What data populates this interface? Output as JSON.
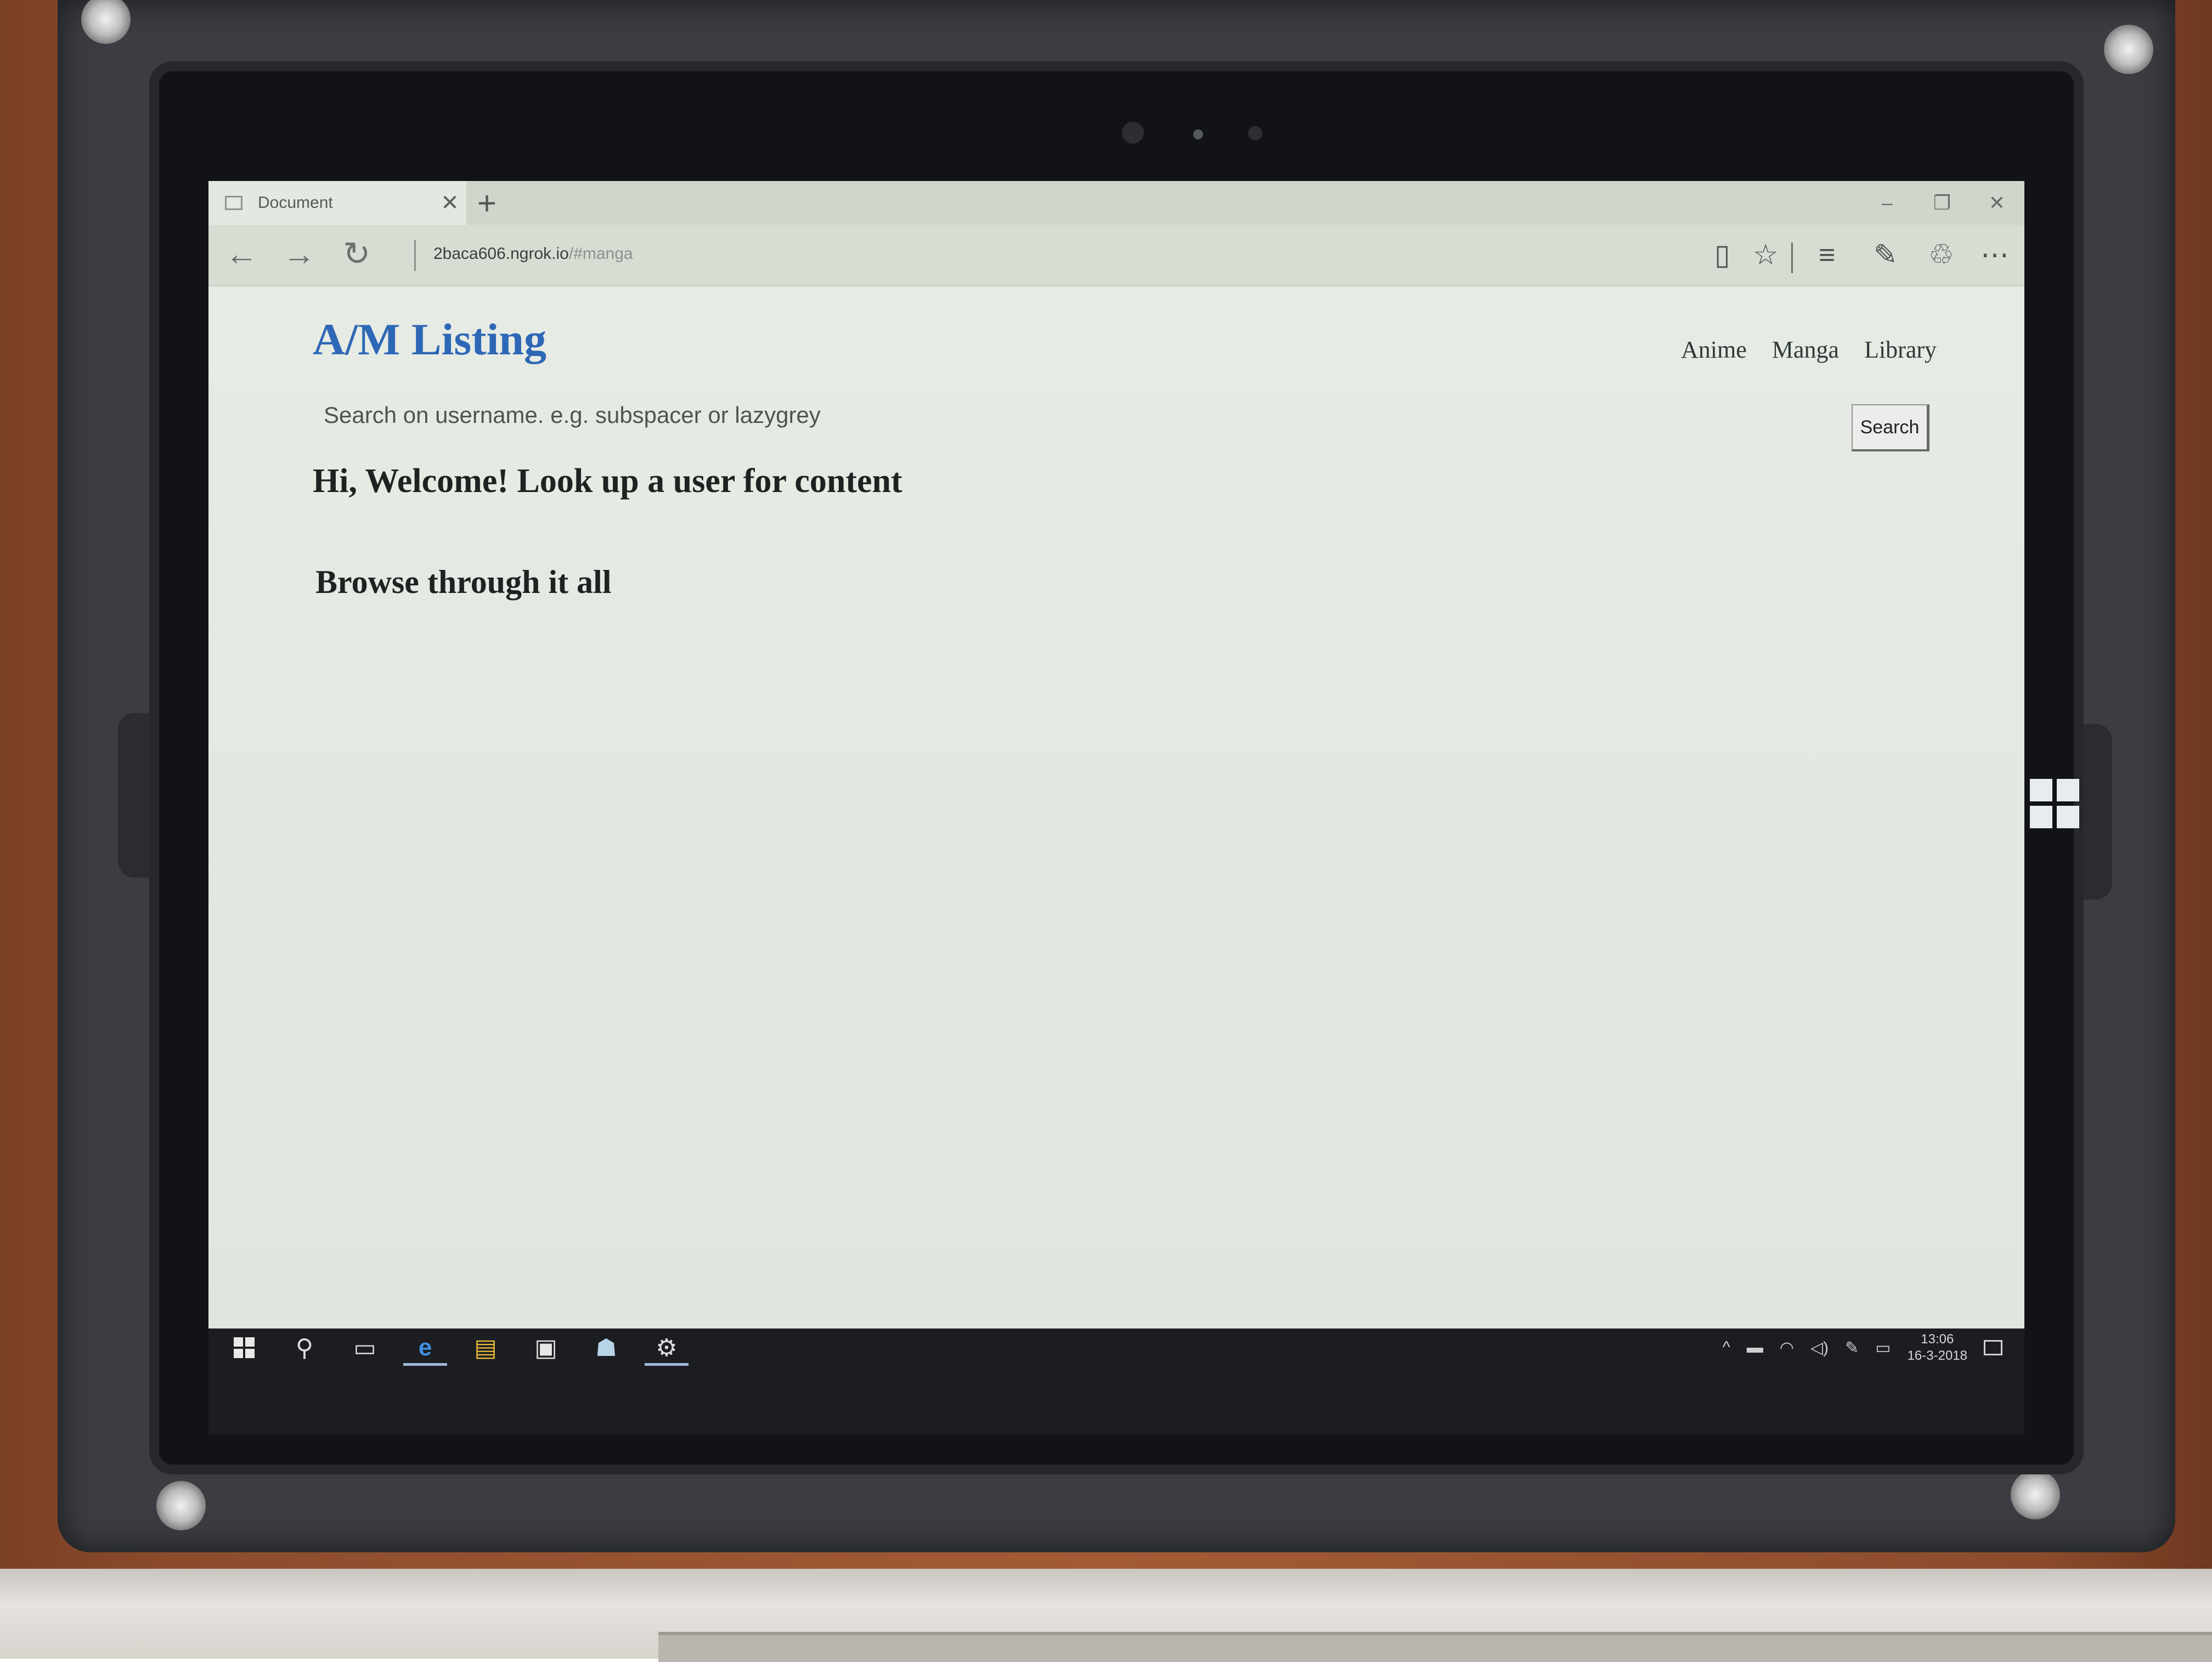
{
  "browser": {
    "tab": {
      "title": "Document",
      "close_icon": "✕"
    },
    "new_tab_icon": "+",
    "window_controls": {
      "minimize": "–",
      "restore": "❐",
      "close": "✕"
    },
    "nav": {
      "back_icon": "←",
      "forward_icon": "→",
      "refresh_icon": "↻"
    },
    "url": {
      "host": "2baca606.ngrok.io",
      "path": "/#manga"
    },
    "toolbar": {
      "reading_view_icon": "▯",
      "favorite_icon": "☆",
      "hub_icon": "≡",
      "web_note_icon": "✎",
      "share_icon": "♲",
      "more_icon": "⋯"
    }
  },
  "page": {
    "site_title": "A/M Listing",
    "nav_links": [
      "Anime",
      "Manga",
      "Library"
    ],
    "search": {
      "placeholder": "Search on username. e.g. subspacer or lazygrey",
      "button_label": "Search"
    },
    "welcome_heading": "Hi, Welcome! Look up a user for content",
    "browse_heading": "Browse through it all"
  },
  "taskbar": {
    "apps": [
      {
        "name": "search",
        "icon": "⚲"
      },
      {
        "name": "task-view",
        "icon": "▭"
      },
      {
        "name": "edge",
        "icon": "e"
      },
      {
        "name": "file-explorer",
        "icon": "▤"
      },
      {
        "name": "store",
        "icon": "▣"
      },
      {
        "name": "app",
        "icon": "☗"
      },
      {
        "name": "settings",
        "icon": "⚙"
      }
    ],
    "tray": {
      "chevron_icon": "^",
      "battery_icon": "▬",
      "wifi_icon": "◠",
      "volume_icon": "◁)",
      "pen_icon": "✎",
      "keyboard_icon": "▭"
    },
    "clock": {
      "time": "13:06",
      "date": "16-3-2018"
    }
  },
  "colors": {
    "site_title": "#2e67b6",
    "page_background": "#e3e9e2",
    "taskbar": "#1b1d21"
  }
}
